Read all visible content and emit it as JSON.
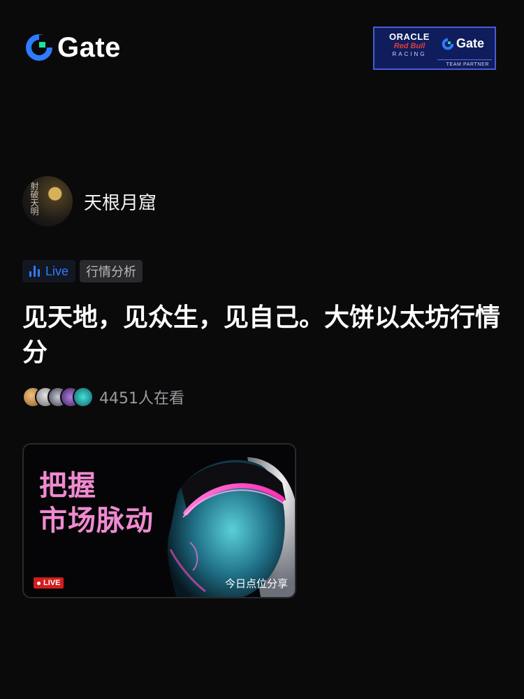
{
  "header": {
    "brand": "Gate",
    "partner": {
      "line1": "ORACLE",
      "line2": "Red Bull",
      "line3": "RACING",
      "brand": "Gate",
      "badge": "TEAM PARTNER"
    }
  },
  "author": {
    "name": "天根月窟",
    "avatar_text": "射破天明"
  },
  "tags": {
    "live": "Live",
    "category": "行情分析"
  },
  "title": "见天地，见众生，见自己。大饼以太坊行情分",
  "viewers": {
    "count_text": "4451人在看"
  },
  "card": {
    "headline_line1": "把握",
    "headline_line2": "市场脉动",
    "live_badge": "LIVE",
    "caption": "今日点位分享"
  },
  "colors": {
    "background": "#0a0a0b",
    "brand_blue": "#2f7bff",
    "brand_green": "#17e5a0",
    "headline_pink": "#f08ad0",
    "live_red": "#d11e1e",
    "partner_navy": "#0f1d5c"
  }
}
